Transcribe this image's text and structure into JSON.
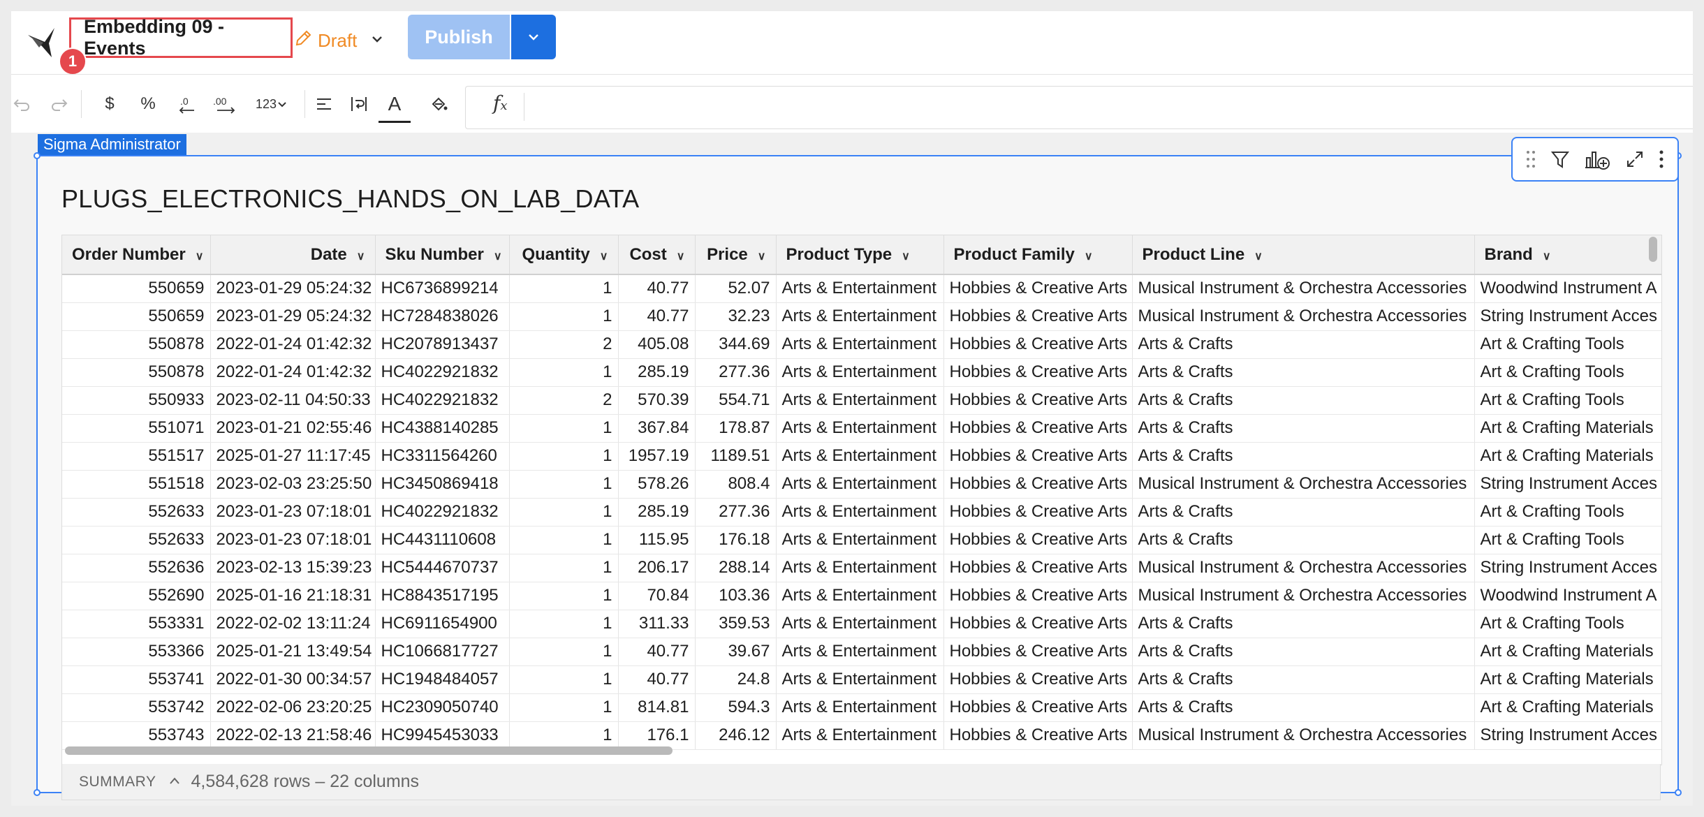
{
  "header": {
    "title": "Embedding 09 - Events",
    "badge": "1",
    "draft_label": "Draft",
    "publish_label": "Publish"
  },
  "toolbar": {
    "currency": "$",
    "percent": "%",
    "number_format": "123"
  },
  "canvas": {
    "user_tag": "Sigma Administrator"
  },
  "table": {
    "title": "PLUGS_ELECTRONICS_HANDS_ON_LAB_DATA",
    "columns": [
      "Order Number",
      "Date",
      "Sku Number",
      "Quantity",
      "Cost",
      "Price",
      "Product Type",
      "Product Family",
      "Product Line",
      "Brand"
    ],
    "rows": [
      [
        "550659",
        "2023-01-29 05:24:32",
        "HC6736899214",
        "1",
        "40.77",
        "52.07",
        "Arts & Entertainment",
        "Hobbies & Creative Arts",
        "Musical Instrument & Orchestra Accessories",
        "Woodwind Instrument A"
      ],
      [
        "550659",
        "2023-01-29 05:24:32",
        "HC7284838026",
        "1",
        "40.77",
        "32.23",
        "Arts & Entertainment",
        "Hobbies & Creative Arts",
        "Musical Instrument & Orchestra Accessories",
        "String Instrument Acces"
      ],
      [
        "550878",
        "2022-01-24 01:42:32",
        "HC2078913437",
        "2",
        "405.08",
        "344.69",
        "Arts & Entertainment",
        "Hobbies & Creative Arts",
        "Arts & Crafts",
        "Art & Crafting Tools"
      ],
      [
        "550878",
        "2022-01-24 01:42:32",
        "HC4022921832",
        "1",
        "285.19",
        "277.36",
        "Arts & Entertainment",
        "Hobbies & Creative Arts",
        "Arts & Crafts",
        "Art & Crafting Tools"
      ],
      [
        "550933",
        "2023-02-11 04:50:33",
        "HC4022921832",
        "2",
        "570.39",
        "554.71",
        "Arts & Entertainment",
        "Hobbies & Creative Arts",
        "Arts & Crafts",
        "Art & Crafting Tools"
      ],
      [
        "551071",
        "2023-01-21 02:55:46",
        "HC4388140285",
        "1",
        "367.84",
        "178.87",
        "Arts & Entertainment",
        "Hobbies & Creative Arts",
        "Arts & Crafts",
        "Art & Crafting Materials"
      ],
      [
        "551517",
        "2025-01-27 11:17:45",
        "HC3311564260",
        "1",
        "1957.19",
        "1189.51",
        "Arts & Entertainment",
        "Hobbies & Creative Arts",
        "Arts & Crafts",
        "Art & Crafting Materials"
      ],
      [
        "551518",
        "2023-02-03 23:25:50",
        "HC3450869418",
        "1",
        "578.26",
        "808.4",
        "Arts & Entertainment",
        "Hobbies & Creative Arts",
        "Musical Instrument & Orchestra Accessories",
        "String Instrument Acces"
      ],
      [
        "552633",
        "2023-01-23 07:18:01",
        "HC4022921832",
        "1",
        "285.19",
        "277.36",
        "Arts & Entertainment",
        "Hobbies & Creative Arts",
        "Arts & Crafts",
        "Art & Crafting Tools"
      ],
      [
        "552633",
        "2023-01-23 07:18:01",
        "HC4431110608",
        "1",
        "115.95",
        "176.18",
        "Arts & Entertainment",
        "Hobbies & Creative Arts",
        "Arts & Crafts",
        "Art & Crafting Tools"
      ],
      [
        "552636",
        "2023-02-13 15:39:23",
        "HC5444670737",
        "1",
        "206.17",
        "288.14",
        "Arts & Entertainment",
        "Hobbies & Creative Arts",
        "Musical Instrument & Orchestra Accessories",
        "String Instrument Acces"
      ],
      [
        "552690",
        "2025-01-16 21:18:31",
        "HC8843517195",
        "1",
        "70.84",
        "103.36",
        "Arts & Entertainment",
        "Hobbies & Creative Arts",
        "Musical Instrument & Orchestra Accessories",
        "Woodwind Instrument A"
      ],
      [
        "553331",
        "2022-02-02 13:11:24",
        "HC6911654900",
        "1",
        "311.33",
        "359.53",
        "Arts & Entertainment",
        "Hobbies & Creative Arts",
        "Arts & Crafts",
        "Art & Crafting Tools"
      ],
      [
        "553366",
        "2025-01-21 13:49:54",
        "HC1066817727",
        "1",
        "40.77",
        "39.67",
        "Arts & Entertainment",
        "Hobbies & Creative Arts",
        "Arts & Crafts",
        "Art & Crafting Materials"
      ],
      [
        "553741",
        "2022-01-30 00:34:57",
        "HC1948484057",
        "1",
        "40.77",
        "24.8",
        "Arts & Entertainment",
        "Hobbies & Creative Arts",
        "Arts & Crafts",
        "Art & Crafting Materials"
      ],
      [
        "553742",
        "2022-02-06 23:20:25",
        "HC2309050740",
        "1",
        "814.81",
        "594.3",
        "Arts & Entertainment",
        "Hobbies & Creative Arts",
        "Arts & Crafts",
        "Art & Crafting Materials"
      ],
      [
        "553743",
        "2022-02-13 21:58:46",
        "HC9945453033",
        "1",
        "176.1",
        "246.12",
        "Arts & Entertainment",
        "Hobbies & Creative Arts",
        "Musical Instrument & Orchestra Accessories",
        "String Instrument Acces"
      ]
    ],
    "summary_label": "SUMMARY",
    "summary_count": "4,584,628 rows – 22 columns"
  }
}
